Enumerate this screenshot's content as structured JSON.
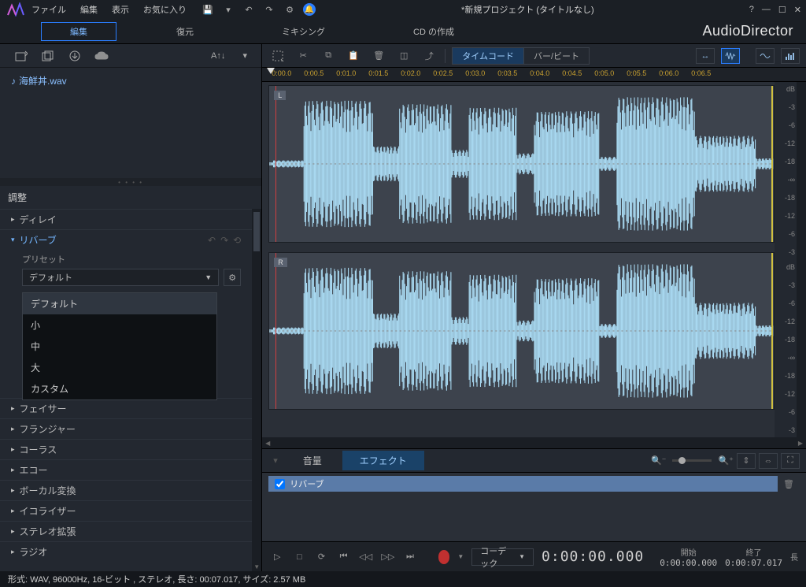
{
  "menu": {
    "file": "ファイル",
    "edit": "編集",
    "view": "表示",
    "fav": "お気に入り"
  },
  "title": "*新規プロジェクト (タイトルなし)",
  "brand": "AudioDirector",
  "modes": {
    "edit": "編集",
    "restore": "復元",
    "mixing": "ミキシング",
    "cd": "CD の作成"
  },
  "left_toolbar": {
    "sort": "A↑↓"
  },
  "files": [
    {
      "name": "海鮮丼.wav"
    }
  ],
  "adjust_header": "調整",
  "effects": {
    "delay": "ディレイ",
    "reverb": "リバーブ",
    "preset_label": "プリセット",
    "current_preset": "デフォルト",
    "options": [
      "デフォルト",
      "小",
      "中",
      "大",
      "カスタム"
    ],
    "phaser": "フェイサー",
    "flanger": "フランジャー",
    "chorus": "コーラス",
    "echo": "エコー",
    "vocal": "ボーカル変換",
    "eq": "イコライザー",
    "stereo": "ステレオ拡張",
    "radio": "ラジオ"
  },
  "right_toolbar": {
    "timecode": "タイムコード",
    "barbeat": "バー/ビート"
  },
  "ruler_ticks": [
    "0:00.0",
    "0:00.5",
    "0:01.0",
    "0:01.5",
    "0:02.0",
    "0:02.5",
    "0:03.0",
    "0:03.5",
    "0:04.0",
    "0:04.5",
    "0:05.0",
    "0:05.5",
    "0:06.0",
    "0:06.5"
  ],
  "channels": {
    "l": "L",
    "r": "R"
  },
  "db_labels": [
    "dB",
    "-3",
    "-6",
    "-12",
    "-18",
    "-∞",
    "-18",
    "-12",
    "-6",
    "-3"
  ],
  "bottom_tabs": {
    "volume": "音量",
    "effect": "エフェクト"
  },
  "fx_strip": {
    "reverb": "リバーブ"
  },
  "transport": {
    "codec": "コーデック",
    "timecode": "0:00:00.000",
    "start_lbl": "開始",
    "end_lbl": "終了",
    "len_lbl": "長",
    "start": "0:00:00.000",
    "end": "0:00:07.017"
  },
  "status": "形式: WAV,  96000Hz,  16-ビット , ステレオ, 長さ:  00:07.017, サイズ: 2.57 MB"
}
